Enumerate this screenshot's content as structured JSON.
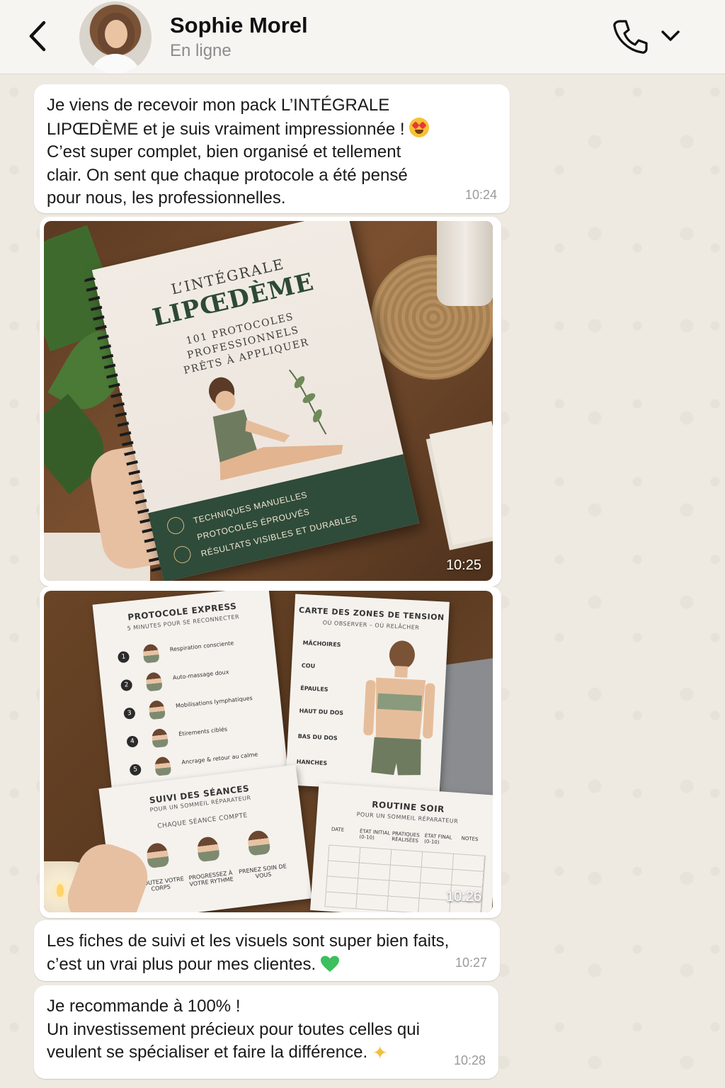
{
  "header": {
    "contact_name": "Sophie Morel",
    "contact_status": "En ligne",
    "icons": [
      "back-arrow-icon",
      "avatar",
      "phone-icon",
      "chevron-down-icon"
    ]
  },
  "messages": [
    {
      "text_lines": [
        "Je viens de recevoir mon pack L’INTÉGRALE",
        "LIPŒDÈME et je suis vraiment impressionnée !",
        "C’est super complet, bien organisé et tellement",
        "clair. On sent que chaque protocole a été pensé",
        "pour nous, les professionnelles."
      ],
      "emoji": "heart-eyes-emoji",
      "time": "10:24"
    },
    {
      "type": "photo",
      "time": "10:25",
      "book": {
        "title_small": "L’INTÉGRALE",
        "title_big": "LIPŒDÈME",
        "subtitle": [
          "101 PROTOCOLES",
          "PROFESSIONNELS",
          "PRÊTS À APPLIQUER"
        ],
        "bullets": [
          "TECHNIQUES MANUELLES",
          "PROTOCOLES ÉPROUVÉS",
          "RÉSULTATS VISIBLES ET DURABLES"
        ]
      }
    },
    {
      "type": "photo",
      "time": "10:26",
      "sheets": {
        "express": {
          "title": "PROTOCOLE EXPRESS",
          "subtitle": "5 MINUTES POUR SE RECONNECTER",
          "steps": [
            "Respiration consciente",
            "Auto-massage doux",
            "Mobilisations lymphatiques",
            "Étirements ciblés",
            "Ancrage & retour au calme"
          ]
        },
        "zones": {
          "title": "CARTE DES ZONES DE TENSION",
          "subtitle": "OÙ OBSERVER – OÙ RELÂCHER",
          "zones": [
            "MÂCHOIRES",
            "COU",
            "ÉPAULES",
            "HAUT DU DOS",
            "BAS DU DOS",
            "HANCHES"
          ]
        },
        "suivi": {
          "title": "SUIVI DES SÉANCES",
          "subtitle": "POUR UN SOMMEIL RÉPARATEUR",
          "tagline": "CHAQUE SÉANCE COMPTE",
          "items": [
            "ÉCOUTEZ VOTRE CORPS",
            "PROGRESSEZ À VOTRE RYTHME",
            "PRENEZ SOIN DE VOUS"
          ]
        },
        "routine": {
          "title": "ROUTINE SOIR",
          "subtitle": "POUR UN SOMMEIL RÉPARATEUR",
          "columns": [
            "DATE",
            "ÉTAT INITIAL (0-10)",
            "PRATIQUES RÉALISÉES",
            "ÉTAT FINAL (0-10)",
            "NOTES"
          ]
        }
      }
    },
    {
      "text_lines": [
        "Les fiches de suivi et les visuels sont super bien faits,",
        "c’est un vrai plus pour mes clientes."
      ],
      "emoji": "green-heart-emoji",
      "time": "10:27"
    },
    {
      "text_lines": [
        "Je recommande à 100% !",
        "Un investissement précieux pour toutes celles qui",
        "veulent se spécialiser et faire la différence."
      ],
      "emoji": "sparkles-emoji",
      "time": "10:28"
    }
  ],
  "colors": {
    "background": "#efeae2",
    "bubble": "#ffffff",
    "header": "#f6f5f2",
    "book_green": "#2f4b3a"
  }
}
